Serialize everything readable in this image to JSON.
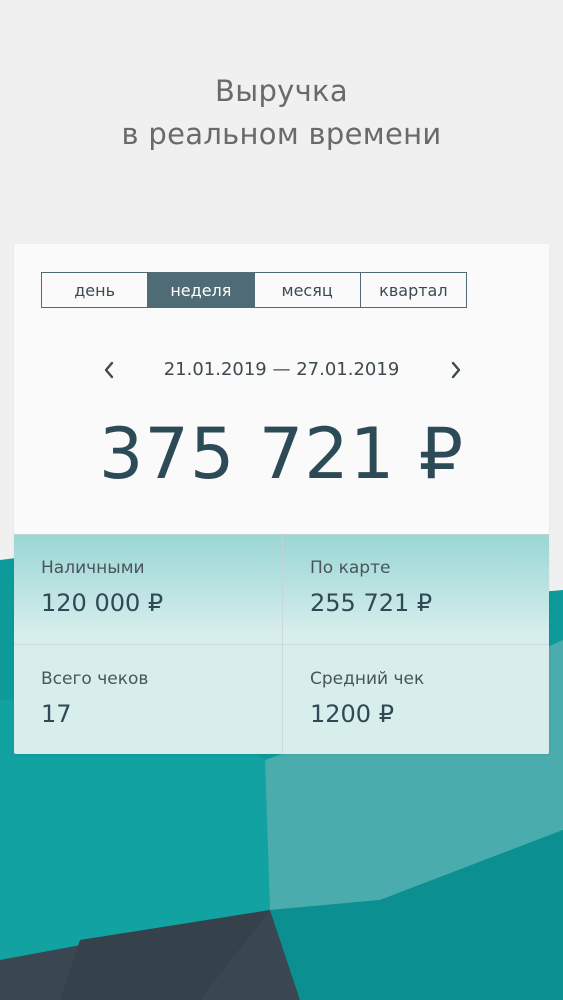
{
  "headline": {
    "line1": "Выручка",
    "line2": "в реальном времени"
  },
  "period_tabs": [
    {
      "label": "день",
      "active": false
    },
    {
      "label": "неделя",
      "active": true
    },
    {
      "label": "месяц",
      "active": false
    },
    {
      "label": "квартал",
      "active": false
    }
  ],
  "date_range": "21.01.2019 — 27.01.2019",
  "total": "375 721 ₽",
  "stats": {
    "cash": {
      "label": "Наличными",
      "value": "120 000 ₽"
    },
    "card": {
      "label": "По карте",
      "value": "255 721 ₽"
    },
    "receipts": {
      "label": "Всего чеков",
      "value": "17"
    },
    "average": {
      "label": "Средний чек",
      "value": "1200 ₽"
    }
  },
  "icons": {
    "prev": "chevron-left-icon",
    "next": "chevron-right-icon"
  },
  "colors": {
    "accent": "#4f6b75",
    "teal": "#0e9a9a",
    "dark": "#3f4a55",
    "background": "#f0f0f1"
  }
}
